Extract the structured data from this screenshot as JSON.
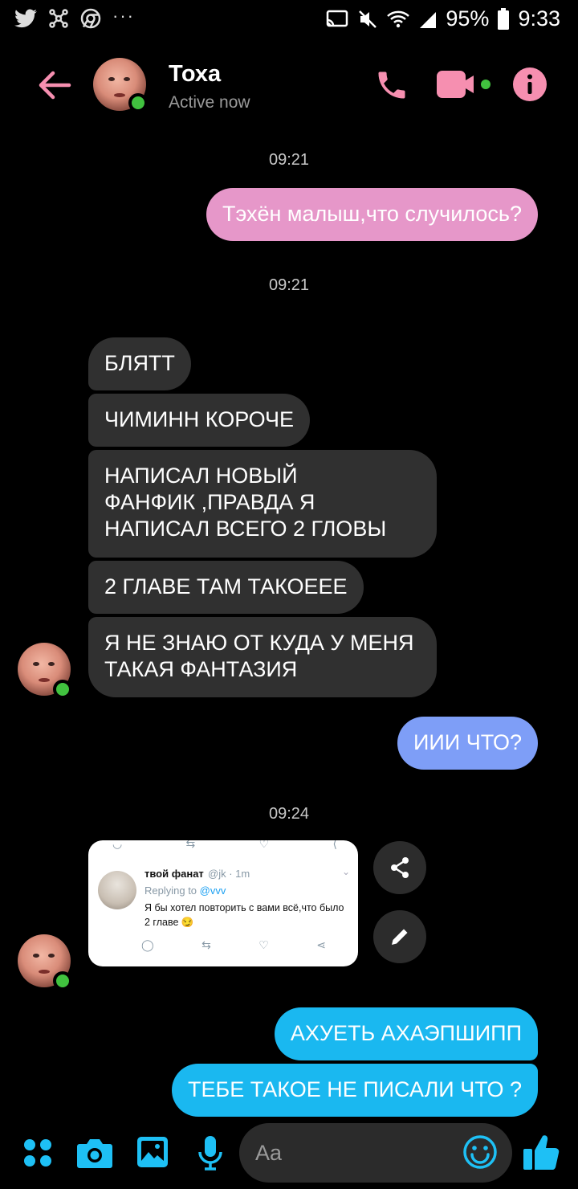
{
  "status_bar": {
    "battery": "95%",
    "time": "9:33",
    "dots": "···"
  },
  "header": {
    "contact_name": "Тоха",
    "status": "Active now"
  },
  "messages": {
    "ts1": "09:21",
    "out1": "Тэхён малыш,что случилось?",
    "ts2": "09:21",
    "in1": "БЛЯТТ",
    "in2": "ЧИМИНН КОРОЧЕ",
    "in3": "НАПИСАЛ НОВЫЙ\nФАНФИК ,ПРАВДА Я\nНАПИСАЛ ВСЕГО 2 ГЛОВЫ",
    "in4": "2 ГЛАВЕ ТАМ ТАКОЕЕЕ",
    "in5": "Я НЕ ЗНАЮ ОТ КУДА У МЕНЯ\nТАКАЯ ФАНТАЗИЯ",
    "out2": "ИИИ ЧТО?",
    "ts3": "09:24",
    "out3": "АХУЕТЬ АХАЭПШИПП",
    "out4": "ТЕБЕ ТАКОЕ НЕ ПИСАЛИ ЧТО ?"
  },
  "tweet": {
    "name": "твой фанат",
    "handle": "@jk · 1m",
    "replying_prefix": "Replying to ",
    "replying_to": "@vvv",
    "text": "Я бы хотел повторить с вами всё,что было 2 главе 😏"
  },
  "composer": {
    "placeholder": "Aa"
  },
  "colors": {
    "accent_pink": "#f68fb0",
    "bubble_pink": "#e697c9",
    "bubble_blue": "#7e9ef7",
    "bubble_cyan": "#1ab8f0",
    "incoming": "#303030",
    "online": "#41c23f",
    "icon_blue": "#1ec0f5"
  }
}
